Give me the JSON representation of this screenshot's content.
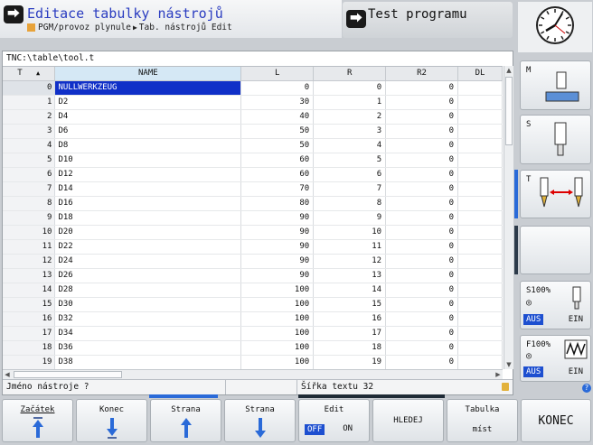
{
  "header": {
    "title": "Editace tabulky nástrojů",
    "breadcrumb": [
      "PGM/provoz plynule",
      "Tab. nástrojů Edit"
    ],
    "secondary_mode": "Test programu"
  },
  "file_path": "TNC:\\table\\tool.t",
  "table": {
    "columns": [
      "T",
      "NAME",
      "L",
      "R",
      "R2",
      "DL"
    ],
    "rows": [
      {
        "t": "0",
        "name": "NULLWERKZEUG",
        "l": "0",
        "r": "0",
        "r2": "0"
      },
      {
        "t": "1",
        "name": "D2",
        "l": "30",
        "r": "1",
        "r2": "0"
      },
      {
        "t": "2",
        "name": "D4",
        "l": "40",
        "r": "2",
        "r2": "0"
      },
      {
        "t": "3",
        "name": "D6",
        "l": "50",
        "r": "3",
        "r2": "0"
      },
      {
        "t": "4",
        "name": "D8",
        "l": "50",
        "r": "4",
        "r2": "0"
      },
      {
        "t": "5",
        "name": "D10",
        "l": "60",
        "r": "5",
        "r2": "0"
      },
      {
        "t": "6",
        "name": "D12",
        "l": "60",
        "r": "6",
        "r2": "0"
      },
      {
        "t": "7",
        "name": "D14",
        "l": "70",
        "r": "7",
        "r2": "0"
      },
      {
        "t": "8",
        "name": "D16",
        "l": "80",
        "r": "8",
        "r2": "0"
      },
      {
        "t": "9",
        "name": "D18",
        "l": "90",
        "r": "9",
        "r2": "0"
      },
      {
        "t": "10",
        "name": "D20",
        "l": "90",
        "r": "10",
        "r2": "0"
      },
      {
        "t": "11",
        "name": "D22",
        "l": "90",
        "r": "11",
        "r2": "0"
      },
      {
        "t": "12",
        "name": "D24",
        "l": "90",
        "r": "12",
        "r2": "0"
      },
      {
        "t": "13",
        "name": "D26",
        "l": "90",
        "r": "13",
        "r2": "0"
      },
      {
        "t": "14",
        "name": "D28",
        "l": "100",
        "r": "14",
        "r2": "0"
      },
      {
        "t": "15",
        "name": "D30",
        "l": "100",
        "r": "15",
        "r2": "0"
      },
      {
        "t": "16",
        "name": "D32",
        "l": "100",
        "r": "16",
        "r2": "0"
      },
      {
        "t": "17",
        "name": "D34",
        "l": "100",
        "r": "17",
        "r2": "0"
      },
      {
        "t": "18",
        "name": "D36",
        "l": "100",
        "r": "18",
        "r2": "0"
      },
      {
        "t": "19",
        "name": "D38",
        "l": "100",
        "r": "19",
        "r2": "0"
      }
    ],
    "selected_row": 0
  },
  "status": {
    "prompt": "Jméno nástroje ?",
    "hint": "Šířka textu 32"
  },
  "side_keys": {
    "m_label": "M",
    "s_label": "S",
    "t_label": "T",
    "spindle_override": "S100%",
    "feed_override": "F100%",
    "off_label": "AUS",
    "on_label": "EIN"
  },
  "softkeys": {
    "start": "Začátek",
    "end": "Konec",
    "page_up": "Strana",
    "page_down": "Strana",
    "edit": "Edit",
    "edit_off": "OFF",
    "edit_on": "ON",
    "find": "HLEDEJ",
    "pocket_table_1": "Tabulka",
    "pocket_table_2": "míst",
    "konec": "KONEC"
  },
  "icons": {
    "mode": "program-mode-icon",
    "clock": "clock-icon",
    "help": "help-icon"
  },
  "colors": {
    "title": "#2a3cc0",
    "selection": "#1030c8",
    "aus_active": "#1d4fd0",
    "accent_bar": "#2a6ad8"
  }
}
